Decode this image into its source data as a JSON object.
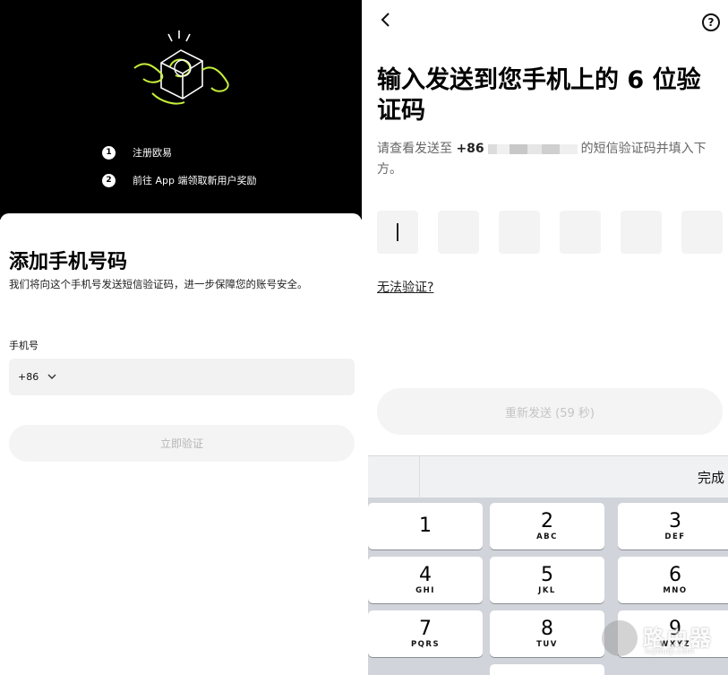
{
  "left_screen": {
    "steps": [
      {
        "num": "1",
        "label": "注册欧易"
      },
      {
        "num": "2",
        "label": "前往 App 端领取新用户奖励"
      }
    ],
    "title": "添加手机号码",
    "description": "我们将向这个手机号发送短信验证码，进一步保障您的账号安全。",
    "phone_label": "手机号",
    "country_code": "+86",
    "phone_value": "",
    "verify_button": "立即验证"
  },
  "right_screen": {
    "back_icon": "chevron-left-icon",
    "help_icon": "?",
    "title": "输入发送到您手机上的 6 位验证码",
    "desc_prefix": "请查看发送至",
    "desc_code": "+86",
    "desc_suffix": "的短信验证码并填入下方。",
    "code_length": 6,
    "cant_verify": "无法验证?",
    "resend_button": "重新发送 (59 秒)",
    "keyboard": {
      "done_label": "完成",
      "keys": [
        {
          "digit": "1",
          "letters": ""
        },
        {
          "digit": "2",
          "letters": "ABC"
        },
        {
          "digit": "3",
          "letters": "DEF"
        },
        {
          "digit": "4",
          "letters": "GHI"
        },
        {
          "digit": "5",
          "letters": "JKL"
        },
        {
          "digit": "6",
          "letters": "MNO"
        },
        {
          "digit": "7",
          "letters": "PQRS"
        },
        {
          "digit": "8",
          "letters": "TUV"
        },
        {
          "digit": "9",
          "letters": "WXYZ"
        }
      ]
    }
  },
  "watermark": {
    "text": "路由器",
    "sub": "luyouqi.com"
  },
  "colors": {
    "hero_bg": "#000000",
    "accent_green": "#c6f03a",
    "keyboard_bg": "#d1d4da",
    "disabled_text": "#b5b5b5"
  }
}
